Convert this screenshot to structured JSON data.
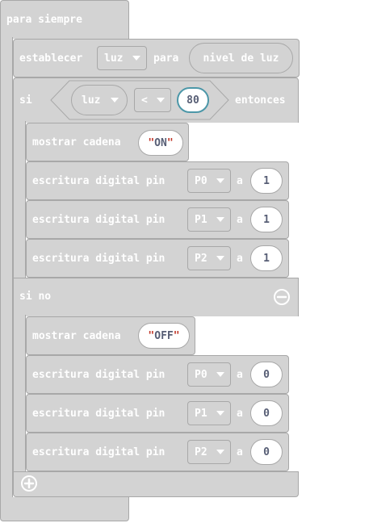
{
  "forever": {
    "label": "para siempre"
  },
  "set_block": {
    "label": "establecer",
    "variable": "luz",
    "to_label": "para",
    "value": "nivel de luz"
  },
  "if_block": {
    "label": "si",
    "compare_left": "luz",
    "operator": "<",
    "compare_right": "80",
    "then_label": "entonces",
    "else_label": "si no",
    "if_branch": {
      "show_label": "mostrar cadena",
      "show_value": "ON",
      "writes": [
        {
          "label": "escritura digital pin",
          "pin": "P0",
          "to": "a",
          "value": "1"
        },
        {
          "label": "escritura digital pin",
          "pin": "P1",
          "to": "a",
          "value": "1"
        },
        {
          "label": "escritura digital pin",
          "pin": "P2",
          "to": "a",
          "value": "1"
        }
      ]
    },
    "else_branch": {
      "show_label": "mostrar cadena",
      "show_value": "OFF",
      "writes": [
        {
          "label": "escritura digital pin",
          "pin": "P0",
          "to": "a",
          "value": "0"
        },
        {
          "label": "escritura digital pin",
          "pin": "P1",
          "to": "a",
          "value": "0"
        },
        {
          "label": "escritura digital pin",
          "pin": "P2",
          "to": "a",
          "value": "0"
        }
      ]
    }
  },
  "icons": {
    "remove": "minus-circle-icon",
    "add": "plus-circle-icon"
  },
  "colors": {
    "block_fill": "#d3d3d3",
    "block_border": "#a8a8a8",
    "text": "#ffffff",
    "pill_text": "#575e75",
    "quote": "#c0392b",
    "selected_outline": "#4c97a8"
  }
}
